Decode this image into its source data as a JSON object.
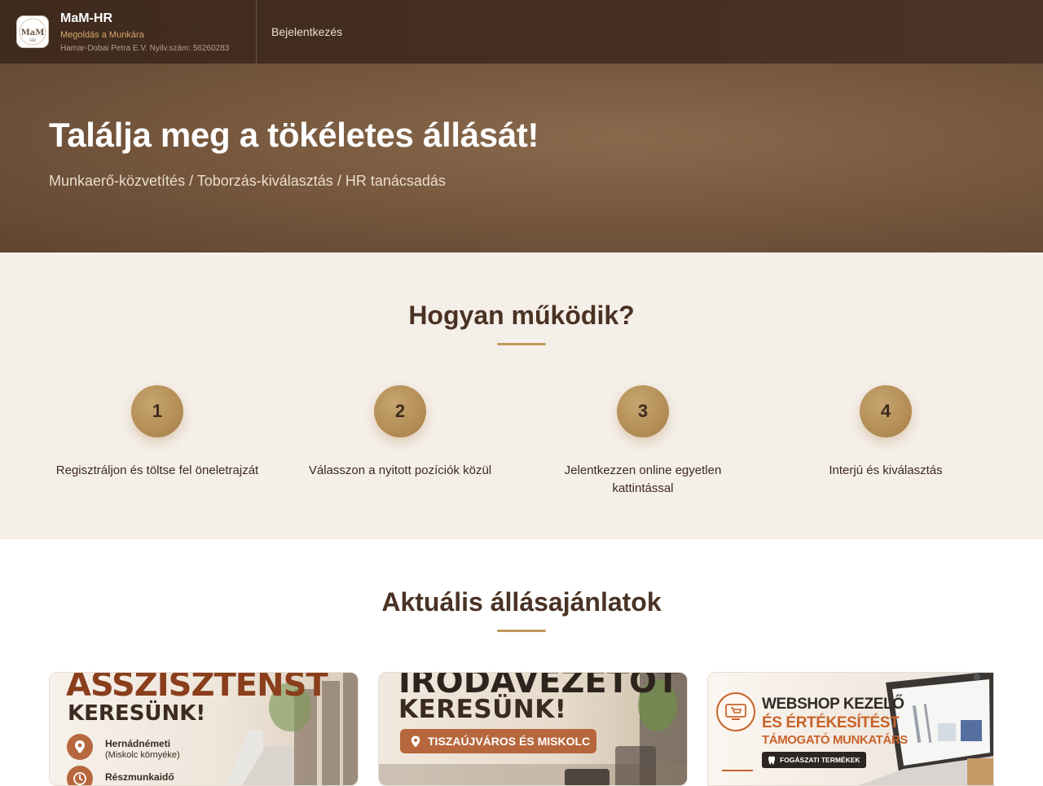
{
  "header": {
    "brand_name": "MaM-HR",
    "tagline": "Megoldás a Munkára",
    "registration": "Hamar-Dobai Petra E.V. Nyilv.szám: 56260283",
    "login_label": "Bejelentkezés",
    "logo_text": "MaM"
  },
  "hero": {
    "title": "Találja meg a tökéletes állását!",
    "subtitle": "Munkaerő-közvetítés / Toborzás-kiválasztás / HR tanácsadás"
  },
  "how": {
    "title": "Hogyan működik?",
    "steps": [
      {
        "number": "1",
        "text": "Regisztráljon és töltse fel öneletrajzát"
      },
      {
        "number": "2",
        "text": "Válasszon a nyitott pozíciók közül"
      },
      {
        "number": "3",
        "text": "Jelentkezzen online egyetlen kattintással"
      },
      {
        "number": "4",
        "text": "Interjú és kiválasztás"
      }
    ]
  },
  "jobs": {
    "title": "Aktuális állásajánlatok",
    "cards": [
      {
        "headline": "ASSZISZTENST",
        "subhead": "KERESÜNK!",
        "location": "Hernádnémeti",
        "location_note": "(Miskolc környéke)",
        "schedule": "Részmunkaidő"
      },
      {
        "headline": "IRODAVEZETŐT",
        "subhead": "KERESÜNK!",
        "location": "TISZAÚJVÁROS ÉS MISKOLC"
      },
      {
        "line1": "WEBSHOP KEZELŐ",
        "line2": "ÉS ÉRTÉKESÍTÉST",
        "line3": "TÁMOGATÓ MUNKATÁRS",
        "badge": "FOGÁSZATI TERMÉKEK"
      }
    ]
  },
  "colors": {
    "header_bg": "#3f2a1e",
    "accent": "#c39a5c",
    "section_bg": "#f5efe9",
    "text_dark": "#4a3224"
  }
}
